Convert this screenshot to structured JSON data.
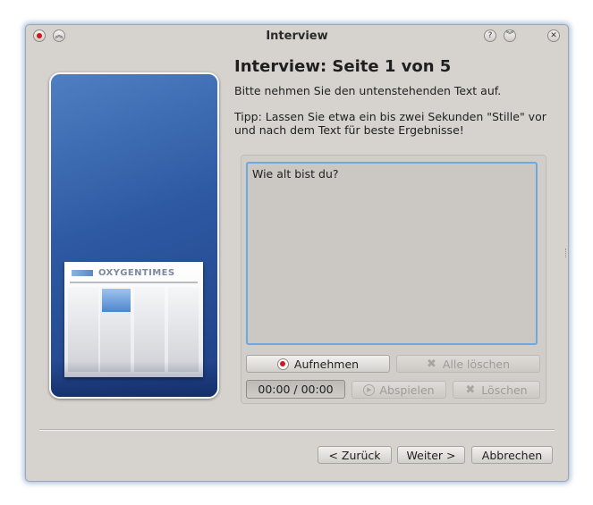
{
  "window": {
    "title": "Interview"
  },
  "side_panel": {
    "brand_text": "OXYGENTIMES"
  },
  "page": {
    "heading": "Interview: Seite 1 von 5",
    "instruction": "Bitte nehmen Sie den untenstehenden Text auf.",
    "tip": "Tipp: Lassen Sie etwa ein bis zwei Sekunden \"Stille\" vor und nach dem Text für beste Ergebnisse!"
  },
  "prompt_text": "Wie alt bist du?",
  "recording": {
    "record_label": "Aufnehmen",
    "clear_all_label": "Alle löschen",
    "time": "00:00 / 00:00",
    "play_label": "Abspielen",
    "delete_label": "Löschen"
  },
  "buttons": {
    "back": "< Zurück",
    "next": "Weiter >",
    "cancel": "Abbrechen"
  },
  "icons": {
    "close": "close-icon",
    "keep_above": "keep-above-icon",
    "help": "help-icon",
    "minimize": "minimize-icon",
    "record": "record-icon",
    "clear": "x-icon",
    "play": "play-icon"
  },
  "colors": {
    "window_bg": "#d6d3cf",
    "accent_focus": "#6fa8dc",
    "record_red": "#d0161e",
    "panel_blue": "#2e5aa3"
  }
}
